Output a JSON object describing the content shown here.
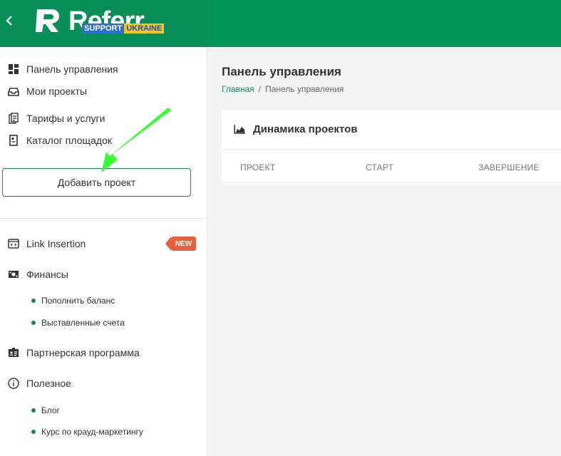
{
  "header": {
    "logo_text": "Referr",
    "badge_left": "SUPPORT",
    "badge_right": "UKRAINE"
  },
  "sidebar": {
    "items": [
      {
        "label": "Панель управления",
        "icon": "dashboard-icon"
      },
      {
        "label": "Мои проекты",
        "icon": "inbox-icon"
      },
      {
        "label": "Тарифы и услуги",
        "icon": "price-list-icon"
      },
      {
        "label": "Каталог площадок",
        "icon": "catalog-icon"
      }
    ],
    "add_button": "Добавить проект",
    "link_insertion": "Link Insertion",
    "new_badge": "NEW",
    "finance": "Финансы",
    "finance_sub": [
      "Пополнить баланс",
      "Выставленные счета"
    ],
    "partner": "Партнерская программа",
    "useful": "Полезное",
    "useful_sub": [
      "Блог",
      "Курс по крауд-маркетингу"
    ]
  },
  "main": {
    "title": "Панель управления",
    "breadcrumb": {
      "home": "Главная",
      "separator": "/",
      "current": "Панель управления"
    },
    "card": {
      "title": "Динамика проектов",
      "columns": [
        "ПРОЕКТ",
        "СТАРТ",
        "ЗАВЕРШЕНИЕ"
      ]
    }
  },
  "colors": {
    "brand": "#00975a",
    "accent": "#0f8a56",
    "badge": "#e8613f",
    "arrow": "#33ff33"
  }
}
